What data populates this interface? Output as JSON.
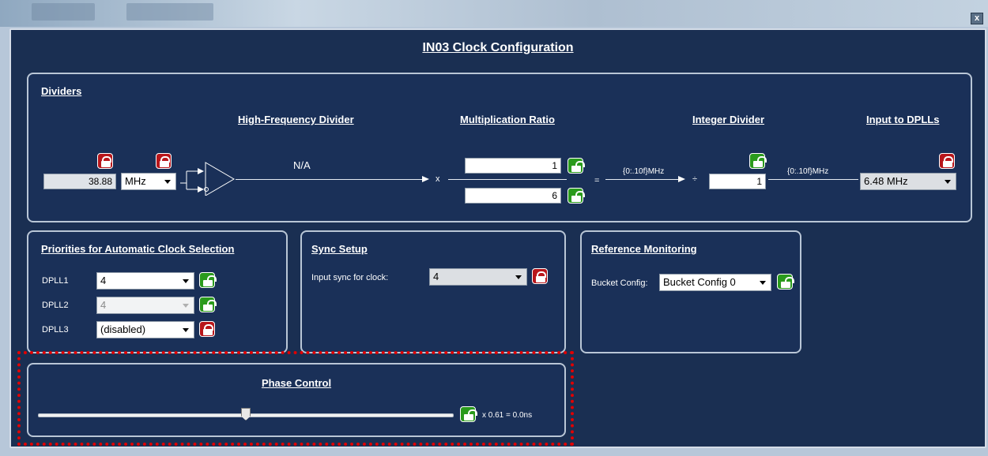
{
  "window": {
    "title": "IN03 Clock Configuration",
    "close_label": "x"
  },
  "dividers": {
    "title": "Dividers",
    "input_freq": "38.88",
    "input_unit": "MHz",
    "hf_divider_label": "High-Frequency Divider",
    "hf_value": "N/A",
    "mult_label": "Multiplication Ratio",
    "times": "x",
    "numerator": "1",
    "denominator": "6",
    "equals": "=",
    "range1": "{0:.10f}MHz",
    "divide": "÷",
    "int_divider_label": "Integer Divider",
    "int_divider_value": "1",
    "range2": "{0:.10f}MHz",
    "dpll_input_label": "Input to DPLLs",
    "dpll_input_value": "6.48 MHz"
  },
  "priorities": {
    "title": "Priorities for Automatic Clock Selection",
    "rows": [
      {
        "label": "DPLL1",
        "value": "4"
      },
      {
        "label": "DPLL2",
        "value": "4"
      },
      {
        "label": "DPLL3",
        "value": "(disabled)"
      }
    ]
  },
  "sync": {
    "title": "Sync Setup",
    "label": "Input sync for clock:",
    "value": "4"
  },
  "refmon": {
    "title": "Reference Monitoring",
    "label": "Bucket Config:",
    "value": "Bucket Config 0"
  },
  "phase": {
    "title": "Phase Control",
    "readout": "x 0.61 = 0.0ns",
    "slider_fraction": 0.5
  },
  "colors": {
    "panel_bg": "#1a3058",
    "lock_locked": "#b8161b",
    "lock_unlocked": "#2a9a1c",
    "highlight": "#e10000"
  }
}
